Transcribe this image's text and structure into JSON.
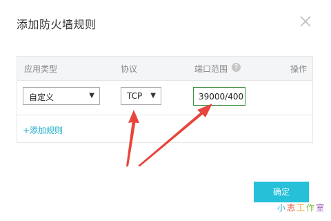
{
  "dialog": {
    "title": "添加防火墙规则",
    "close_icon": "close-icon",
    "columns": {
      "app_type": "应用类型",
      "protocol": "协议",
      "port_range": "端口范围",
      "operation": "操作"
    },
    "help_icon": "question-circle-icon",
    "row": {
      "app_type_value": "自定义",
      "protocol_value": "TCP",
      "port_value": "39000/400"
    },
    "add_rule_label": "+添加规则",
    "confirm_label": "确定"
  },
  "watermark": {
    "chars": [
      "小",
      "志",
      "工",
      "作",
      "室"
    ],
    "colors": [
      "#2aa8e0",
      "#e6492a",
      "#f0a52a",
      "#7ac142",
      "#9b59b6"
    ]
  },
  "colors": {
    "accent": "#26c0d8",
    "link": "#1aaccc",
    "annotation_arrow": "#e8453c",
    "port_border": "#3a8e3a"
  }
}
